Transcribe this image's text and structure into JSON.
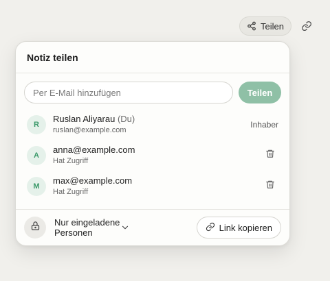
{
  "topbar": {
    "share_label": "Teilen"
  },
  "panel": {
    "title": "Notiz teilen",
    "invite": {
      "placeholder": "Per E-Mail hinzufügen",
      "button_label": "Teilen"
    },
    "members": [
      {
        "initial": "R",
        "name": "Ruslan Aliyarau",
        "you_tag": "(Du)",
        "sub": "ruslan@example.com",
        "role": "Inhaber"
      },
      {
        "initial": "A",
        "name": "anna@example.com",
        "sub": "Hat Zugriff"
      },
      {
        "initial": "M",
        "name": "max@example.com",
        "sub": "Hat Zugriff"
      }
    ],
    "footer": {
      "access_label": "Nur eingeladene Personen",
      "copy_label": "Link kopieren"
    }
  },
  "colors": {
    "accent": "#8fc0a6",
    "avatar_bg": "#e5f1ea",
    "avatar_text": "#3d9a6b",
    "background": "#f1f0ec"
  },
  "icons": [
    "share-icon",
    "link-icon",
    "trash-icon",
    "lock-icon",
    "chevron-down-icon"
  ]
}
